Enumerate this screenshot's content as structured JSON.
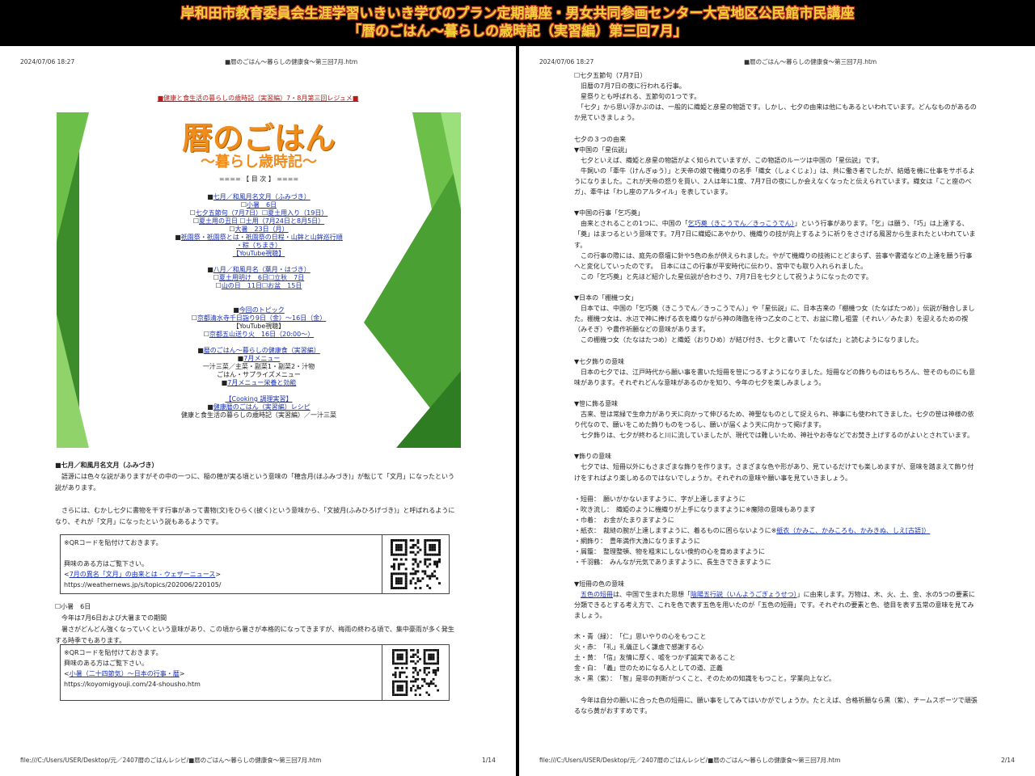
{
  "banner": {
    "line1": "岸和田市教育委員会生涯学習いきいき学びのプラン定期講座・男女共同参画センター大宮地区公民館市民講座",
    "line2": "「暦のごはん～暮らしの歳時記（実習編）第三回7月」"
  },
  "page1": {
    "header_date": "2024/07/06 18:27",
    "header_title": "■暦のごはん～暮らしの健康食～第三回7月.htm",
    "resume_title": "■健康と食生活の暮らしの歳時記（実習編）7・8月第三回レジュメ■",
    "banner_title": "暦のごはん",
    "banner_subtitle": "～暮らし歳時記～",
    "toc_label": "==== 【 目 次 】 ====",
    "toc": [
      {
        "pre": "■",
        "text": "七月／和風月名文月（ふみづき）",
        "link": true
      },
      {
        "pre": "☐",
        "text": "小暑　6日",
        "link": true
      },
      {
        "pre": "☐",
        "text": "七夕五節句（7月7日）☐夏土用入り（19日）",
        "link": true
      },
      {
        "pre": "☐",
        "text": "夏土用の丑日 ☐土用（7月24日と8月5日）",
        "link": true
      },
      {
        "pre": "☐",
        "text": "大暑　23日（月）",
        "link": true
      },
      {
        "pre": "■",
        "text": "祇園祭・祇園祭とは・祇園祭の日程・山鉾と山鉾巡行順",
        "link": true
      },
      {
        "pre": "",
        "text": "・粽（ちまき）",
        "link": true
      },
      {
        "pre": "",
        "text": "【YouTube視聴】",
        "link": true
      },
      {
        "pre": "",
        "text": "",
        "link": false
      },
      {
        "pre": "■",
        "text": "八月／和風月名（葉月・はづき）",
        "link": true
      },
      {
        "pre": "☐",
        "text": "夏土用明け　6日☐立秋　7日",
        "link": true
      },
      {
        "pre": "☐",
        "text": "山の日　11日☐お盆　15日",
        "link": true
      },
      {
        "pre": "",
        "text": "",
        "link": false
      },
      {
        "pre": "",
        "text": "",
        "link": false
      },
      {
        "pre": "■",
        "text": "今回のトピック",
        "link": true
      },
      {
        "pre": "☐",
        "text": "京都清水寺千日詣り9日（金）～16日（金）",
        "link": true
      },
      {
        "pre": "",
        "text": "【YouTube視聴】",
        "link": false
      },
      {
        "pre": "☐",
        "text": "京都五山送り火　16日（20:00～）",
        "link": true
      },
      {
        "pre": "",
        "text": "",
        "link": false
      },
      {
        "pre": "■",
        "text": "暦のごはん～暮らしの健康食（実習編）",
        "link": true
      },
      {
        "pre": "■",
        "text": "7月メニュー",
        "link": true
      },
      {
        "pre": "",
        "text": "一汁三菜／主菜・副菜1・副菜2・汁物",
        "link": false
      },
      {
        "pre": "",
        "text": "ごはん・サプライズメニュー",
        "link": false
      },
      {
        "pre": "■",
        "text": "7月メニュー栄養と効能",
        "link": true
      },
      {
        "pre": "",
        "text": "",
        "link": false
      },
      {
        "pre": "",
        "text": "【Cooking 調理実習】",
        "link": true
      },
      {
        "pre": "■",
        "text": "健康暦のごはん（実習編）レシピ",
        "link": true
      },
      {
        "pre": "",
        "text": "健康と食生活の暮らしの歳時記（実習編）／一汁三菜",
        "link": false
      }
    ],
    "s1_heading": "■七月／和風月名文月（ふみづき）",
    "s1_p1": "　語源には色々な説がありますがその中の一つに、稲の穂が実る頃という意味の「穂含月(ほふみづき)」が転じて「文月」になったという説があります。",
    "s1_p2": "　さらには、むかし七夕に書物を干す行事があって書物(文)をひらく(披く)という意味から、「文披月(ふみひろげづき)」と呼ばれるようになり、それが「文月」になったという説もあるようです。",
    "qr1": {
      "note": "※QRコードを貼付けておきます。",
      "intro": "興味のある方はご覧下さい。",
      "link_pre": "<",
      "link": "7月の異名「文月」の由来とは - ウェザーニュース",
      "link_post": ">",
      "url": "https://weathernews.jp/s/topics/202006/220105/"
    },
    "s2_heading": "☐小暑　6日",
    "s2_p1": "　今年は7月6日および大暑までの期間",
    "s2_p2": "　暑さがどんどん強くなっていくという意味があり、この頃から暑さが本格的になってきますが、梅雨の終わる頃で、集中豪雨が多く発生する時季でもあります。",
    "qr2": {
      "note": "※QRコードを貼付けておきます。",
      "intro": "興味のある方はご覧下さい。",
      "link_pre": "<",
      "link": "小暑（二十四節気）～日本の行事・暦",
      "link_post": ">",
      "url": "https://koyomigyouji.com/24-shousho.htm"
    },
    "footer_path": "file:///C:/Users/USER/Desktop/元／2407暦のごはんレシピ/■暦のごはん～暮らしの健康食～第三回7月.htm",
    "footer_page": "1/14"
  },
  "page2": {
    "header_date": "2024/07/06 18:27",
    "header_title": "■暦のごはん～暮らしの健康食～第三回7月.htm",
    "footer_path": "file:///C:/Users/USER/Desktop/元／2407暦のごはんレシピ/■暦のごはん～暮らしの健康食～第三回7月.htm",
    "footer_page": "2/14",
    "lines": {
      "l01": "☐七夕五節句（7月7日）",
      "l02": "　旧暦の7月7日の夜に行われる行事。",
      "l03": "　星祭りとも呼ばれる、五節句の1つです。",
      "l04": "　「七夕」から思い浮かぶのは、一般的に織姫と彦星の物語です。しかし、七夕の由来は他にもあるといわれています。どんなものがあるのか見ていきましょう。",
      "l05": "七夕の３つの由来",
      "l06": "▼中国の「星伝説」",
      "l07": "　七夕といえば、織姫と彦星の物語がよく知られていますが、この物語のルーツは中国の「星伝説」です。",
      "l08": "　牛飼いの「牽牛（けんぎゅう）」と天帝の娘で機織りの名手「織女（しょくじょ）」は、共に働き者でしたが、結婚を機に仕事をサボるようになりました。これが天帝の怒りを買い、2人は年に1度、7月7日の夜にしか会えなくなったと伝えられています。織女は「こと座のベガ」、牽牛は「わし座のアルタイル」を表しています。",
      "l09": "▼中国の行事「乞巧奠」",
      "l10a": "　由来とされることの1つに、中国の「",
      "l10link": "乞巧奠（きこうでん／きっこうでん）",
      "l10b": "」という行事があります。「乞」は願う、「巧」は上達する、「奠」はまつるという意味です。7月7日に織姫にあやかり、機織りの技が向上するように祈りをささげる風習から生まれたといわれています。",
      "l11": "　この行事の際には、庭先の祭壇に針や5色の糸が供えられました。やがて機織りの技術にとどまらず、芸事や書道などの上達を願う行事へと変化していったのです。　日本にはこの行事が平安時代に伝わり、宮中でも取り入れられました。",
      "l12": "　この「乞巧奠」と先ほど紹介した星伝説が合わさり、7月7日を七夕として祝うようになったのです。",
      "l13": "▼日本の「棚機つ女」",
      "l14": "　日本では、中国の「乞巧奠（きこうでん／きっこうでん）」や「星伝説」に、日本古来の「棚機つ女（たなばたつめ）」伝説が融合しました。棚機つ女は、水辺で神に捧げる衣を織りながら神の降臨を待つ乙女のことで、お盆に際し祖霊（それい／みたま）を迎えるための禊（みそぎ）や農作祈願などの意味があります。",
      "l15": "　この棚機つ女（たなはたつめ）と織姫（おりひめ）が結び付き、七夕と書いて「たなばた」と読むようになりました。",
      "l16": "▼七夕飾りの意味",
      "l17": "　日本の七夕では、江戸時代から願い事を書いた短冊を笹につるすようになりました。短冊などの飾りものはもちろん、笹そのものにも意味があります。それぞれどんな意味があるのかを知り、今年の七夕を楽しみましょう。",
      "l18": "▼笹に飾る意味",
      "l19": "　古来、笹は常緑で生命力があり天に向かって伸びるため、神聖なものとして捉えられ、神事にも使われてきました。七夕の笹は神様の依り代なので、願いをこめた飾りものをつるし、願いが届くよう天に向かって掲げます。",
      "l20": "　七夕飾りは、七夕が終わると川に流していましたが、現代では難しいため、神社やお寺などでお焚き上げするのがよいとされています。",
      "l21": "▼飾りの意味",
      "l22": "　七夕では、短冊以外にもさまざまな飾りを作ります。さまざまな色や形があり、見ているだけでも楽しめますが、意味を踏まえて飾り付けをすればより楽しめるのではないでしょうか。それぞれの意味や願い事を見ていきましょう。",
      "k1": "・短冊：　願いがかないますように、字が上達しますように",
      "k2": "・吹き流し：　織姫のように機織りが上手になりますように※魔除の意味もあります",
      "k3": "・巾着：　お金がたまりますように",
      "k4a": "・紙衣：　裁縫の腕が上達しますように、着るものに困らないように※",
      "k4link": "紙衣（かみこ、かみころも、かみきぬ、しえ[古語]）",
      "k5": "・網飾り：　豊年満作大漁になりますように",
      "k6": "・屑籠：　整理整頓、物を粗末にしない倹約の心を育めますように",
      "k7": "・千羽鶴：　みんなが元気でありますように、長生きできますように",
      "l23": "▼短冊の色の意味",
      "l24link1": "五色の短冊",
      "l24a": "は、中国で生まれた思想「",
      "l24link2": "陰陽五行説（いんようごぎょうせつ）",
      "l24b": "」に由来します。万物は、木、火、土、金、水の5つの要素に分類できるとする考え方で、これを色で表す五色を用いたのが「五色の短冊」です。それぞれの要素と色、徳目を表す五常の意味を見てみましょう。",
      "c1": "木・青（緑）：　「仁」思いやりの心をもつこと",
      "c2": "火・赤：　「礼」礼儀正しく謙虚で感謝する心",
      "c3": "土・黄：　「信」友情に厚く、嘘をつかず誠実であること",
      "c4": "金・白：　「義」世のためになる人としての道、正義",
      "c5": "水・黒（紫）：　「智」是非の判断がつくこと、そのための知識をもつこと。学業向上など。",
      "l25": "　今年は自分の願いに合った色の短冊に、願い事をしてみてはいかがでしょうか。たとえば、合格祈願なら黒（紫）、チームスポーツで頑張るなら黄がおすすめです。"
    }
  }
}
